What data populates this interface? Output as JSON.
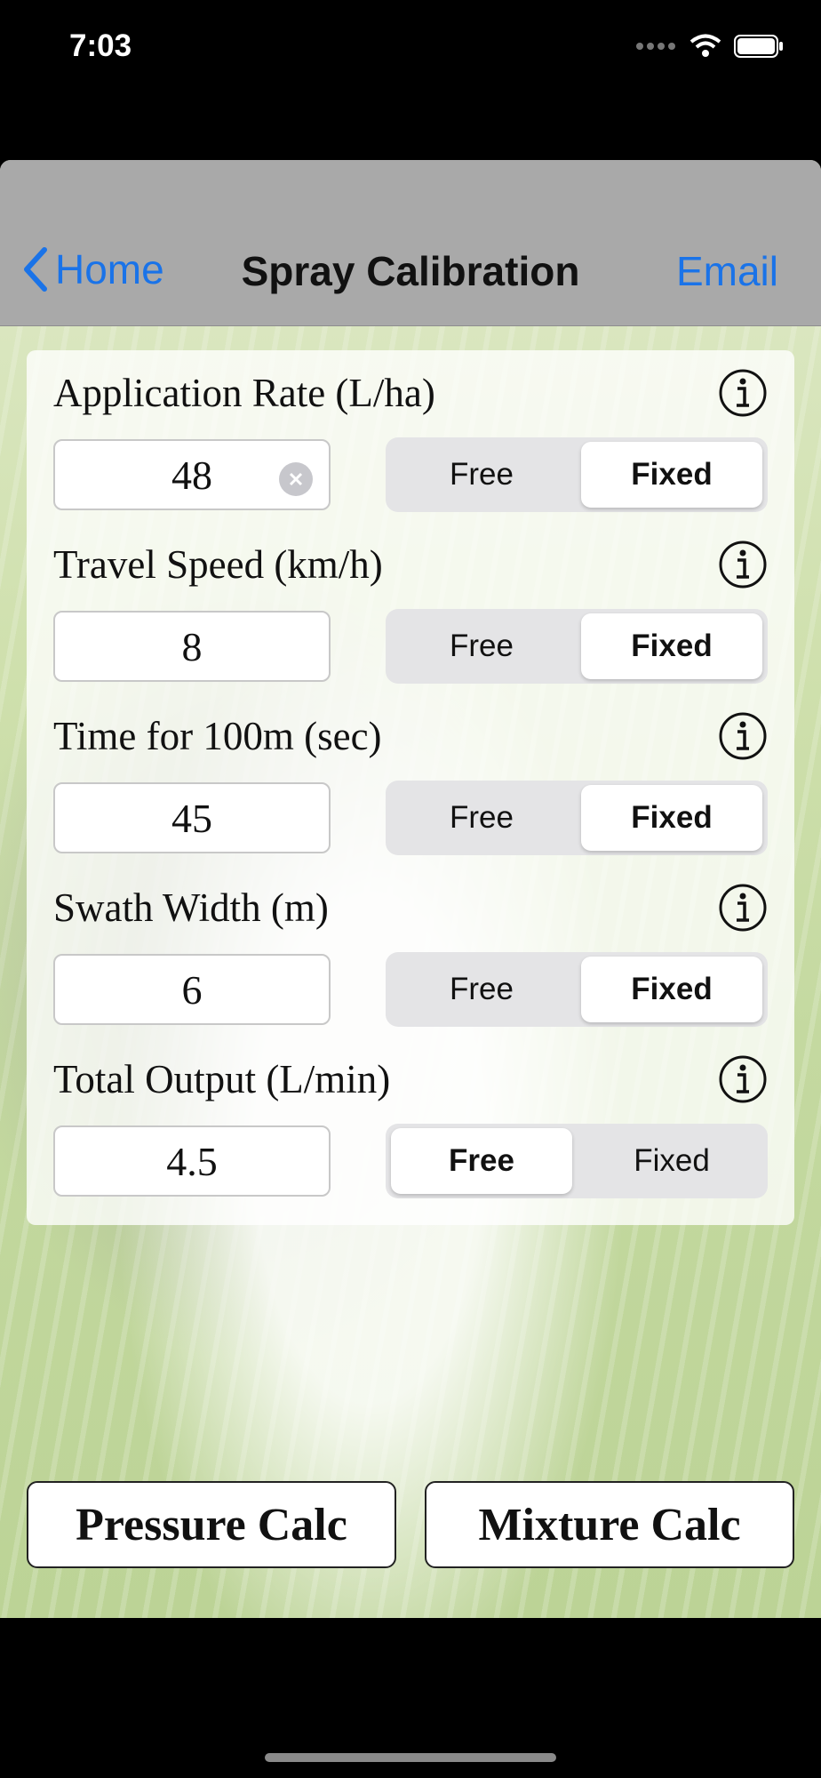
{
  "status": {
    "time": "7:03"
  },
  "nav": {
    "back_label": "Home",
    "title": "Spray Calibration",
    "email_label": "Email"
  },
  "rows": [
    {
      "label": "Application Rate (L/ha)",
      "value": "48",
      "free": "Free",
      "fixed": "Fixed",
      "selected": "fixed",
      "editing": true
    },
    {
      "label": "Travel Speed (km/h)",
      "value": "8",
      "free": "Free",
      "fixed": "Fixed",
      "selected": "fixed"
    },
    {
      "label": "Time for 100m (sec)",
      "value": "45",
      "free": "Free",
      "fixed": "Fixed",
      "selected": "fixed"
    },
    {
      "label": "Swath Width (m)",
      "value": "6",
      "free": "Free",
      "fixed": "Fixed",
      "selected": "fixed"
    },
    {
      "label": "Total Output (L/min)",
      "value": "4.5",
      "free": "Free",
      "fixed": "Fixed",
      "selected": "free"
    }
  ],
  "buttons": {
    "pressure": "Pressure Calc",
    "mixture": "Mixture Calc"
  },
  "colors": {
    "accent": "#1a73e8",
    "navbar": "#a9a9a9"
  }
}
